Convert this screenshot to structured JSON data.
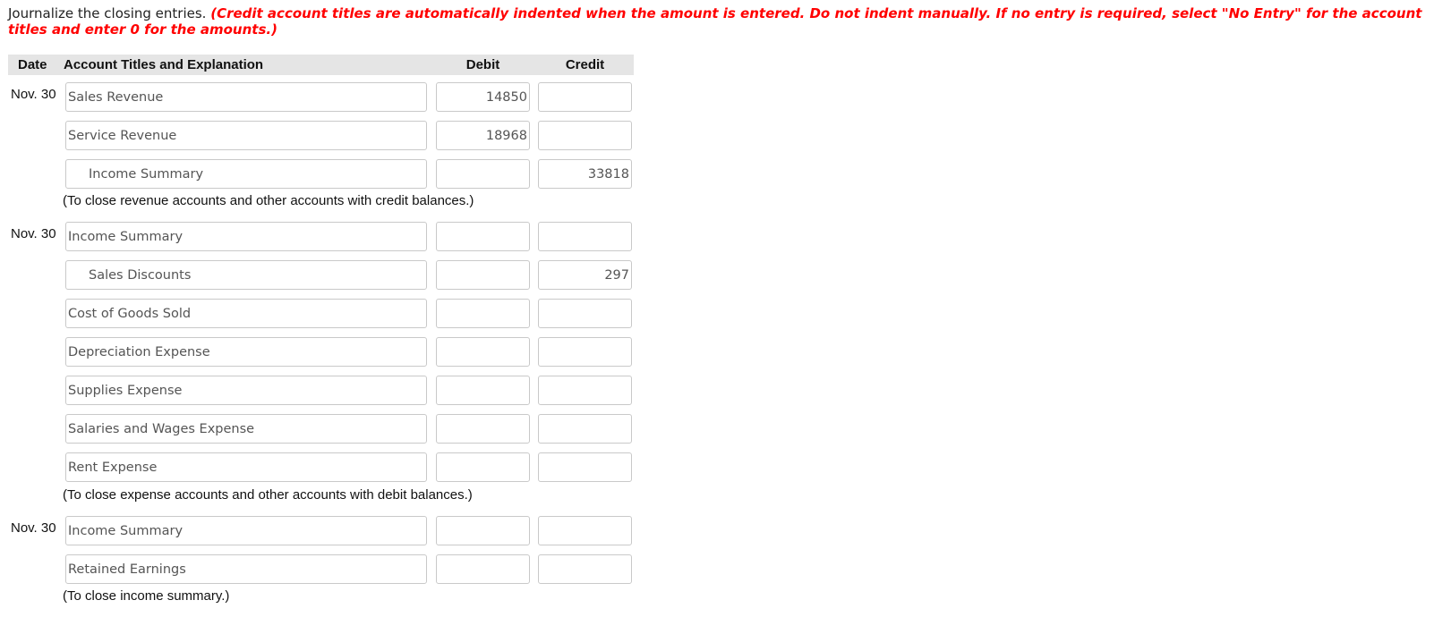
{
  "instructions": {
    "text": "Journalize the closing entries.",
    "note": "(Credit account titles are automatically indented when the amount is entered. Do not indent manually. If no entry is required, select \"No Entry\" for the account titles and enter 0 for the amounts.)"
  },
  "colors": {
    "note": "#ff0000",
    "header_bg": "#e5e5e5",
    "input_border": "#c9c9c9"
  },
  "table": {
    "headers": {
      "date": "Date",
      "account": "Account Titles and Explanation",
      "debit": "Debit",
      "credit": "Credit"
    }
  },
  "entries": [
    {
      "date": "Nov. 30",
      "lines": [
        {
          "account": "Sales Revenue",
          "indented": false,
          "debit": "14850",
          "credit": ""
        },
        {
          "account": "Service Revenue",
          "indented": false,
          "debit": "18968",
          "credit": ""
        },
        {
          "account": "Income Summary",
          "indented": true,
          "debit": "",
          "credit": "33818"
        }
      ],
      "explanation": "(To close revenue accounts and other accounts with credit balances.)"
    },
    {
      "date": "Nov. 30",
      "lines": [
        {
          "account": "Income Summary",
          "indented": false,
          "debit": "",
          "credit": ""
        },
        {
          "account": "Sales Discounts",
          "indented": true,
          "debit": "",
          "credit": "297"
        },
        {
          "account": "Cost of Goods Sold",
          "indented": false,
          "debit": "",
          "credit": ""
        },
        {
          "account": "Depreciation Expense",
          "indented": false,
          "debit": "",
          "credit": ""
        },
        {
          "account": "Supplies Expense",
          "indented": false,
          "debit": "",
          "credit": ""
        },
        {
          "account": "Salaries and Wages Expense",
          "indented": false,
          "debit": "",
          "credit": ""
        },
        {
          "account": "Rent Expense",
          "indented": false,
          "debit": "",
          "credit": ""
        }
      ],
      "explanation": "(To close expense accounts and other accounts with debit balances.)"
    },
    {
      "date": "Nov. 30",
      "lines": [
        {
          "account": "Income Summary",
          "indented": false,
          "debit": "",
          "credit": ""
        },
        {
          "account": "Retained Earnings",
          "indented": false,
          "debit": "",
          "credit": ""
        }
      ],
      "explanation": "(To close income summary.)"
    }
  ]
}
